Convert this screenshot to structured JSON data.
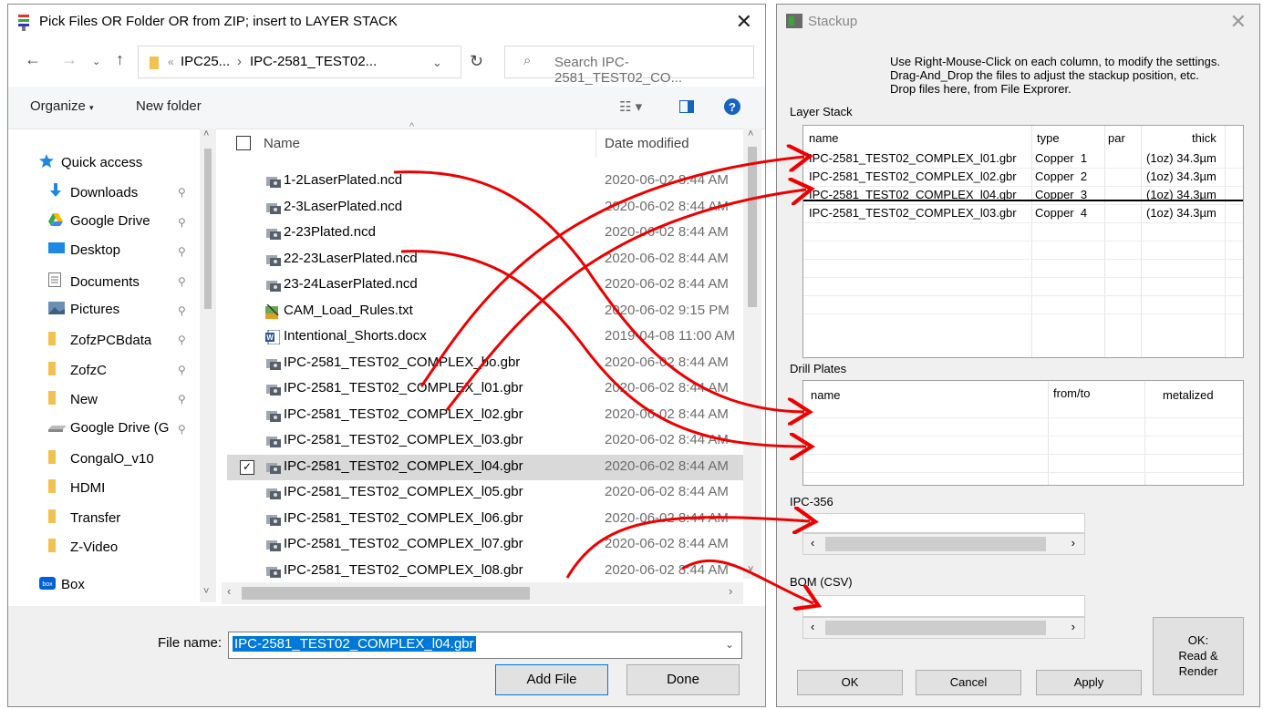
{
  "file_dialog": {
    "title": "Pick Files OR Folder OR from ZIP; insert to LAYER STACK",
    "breadcrumb": [
      "IPC25...",
      "IPC-2581_TEST02..."
    ],
    "search_placeholder": "Search IPC-2581_TEST02_CO...",
    "toolbar": {
      "organize": "Organize",
      "new_folder": "New folder"
    },
    "nav": [
      {
        "label": "Quick access",
        "icon": "star-icon"
      },
      {
        "label": "Downloads",
        "icon": "download-arrow-icon",
        "pinned": true
      },
      {
        "label": "Google Drive",
        "icon": "google-drive-icon",
        "pinned": true
      },
      {
        "label": "Desktop",
        "icon": "desktop-icon",
        "pinned": true
      },
      {
        "label": "Documents",
        "icon": "documents-icon",
        "pinned": true
      },
      {
        "label": "Pictures",
        "icon": "pictures-icon",
        "pinned": true
      },
      {
        "label": "ZofzPCBdata",
        "icon": "folder-icon",
        "pinned": true
      },
      {
        "label": "ZofzC",
        "icon": "folder-icon",
        "pinned": true
      },
      {
        "label": "New",
        "icon": "folder-icon",
        "pinned": true
      },
      {
        "label": "Google Drive (G",
        "icon": "drive-icon",
        "pinned": true
      },
      {
        "label": "CongalO_v10",
        "icon": "folder-icon"
      },
      {
        "label": "HDMI",
        "icon": "folder-icon"
      },
      {
        "label": "Transfer",
        "icon": "folder-icon"
      },
      {
        "label": "Z-Video",
        "icon": "folder-icon"
      },
      {
        "label": "Box",
        "icon": "box-icon"
      }
    ],
    "columns": {
      "name": "Name",
      "date": "Date modified"
    },
    "files": [
      {
        "name": "1-2LaserPlated.ncd",
        "date": "2020-06-02 8:44 AM",
        "icon": "ncd-file-icon"
      },
      {
        "name": "2-3LaserPlated.ncd",
        "date": "2020-06-02 8:44 AM",
        "icon": "ncd-file-icon"
      },
      {
        "name": "2-23Plated.ncd",
        "date": "2020-06-02 8:44 AM",
        "icon": "ncd-file-icon"
      },
      {
        "name": "22-23LaserPlated.ncd",
        "date": "2020-06-02 8:44 AM",
        "icon": "ncd-file-icon"
      },
      {
        "name": "23-24LaserPlated.ncd",
        "date": "2020-06-02 8:44 AM",
        "icon": "ncd-file-icon"
      },
      {
        "name": "CAM_Load_Rules.txt",
        "date": "2020-06-02 9:15 PM",
        "icon": "text-file-icon"
      },
      {
        "name": "Intentional_Shorts.docx",
        "date": "2019-04-08 11:00 AM",
        "icon": "word-file-icon"
      },
      {
        "name": "IPC-2581_TEST02_COMPLEX_bo.gbr",
        "date": "2020-06-02 8:44 AM",
        "icon": "gerber-file-icon"
      },
      {
        "name": "IPC-2581_TEST02_COMPLEX_l01.gbr",
        "date": "2020-06-02 8:44 AM",
        "icon": "gerber-file-icon"
      },
      {
        "name": "IPC-2581_TEST02_COMPLEX_l02.gbr",
        "date": "2020-06-02 8:44 AM",
        "icon": "gerber-file-icon"
      },
      {
        "name": "IPC-2581_TEST02_COMPLEX_l03.gbr",
        "date": "2020-06-02 8:44 AM",
        "icon": "gerber-file-icon"
      },
      {
        "name": "IPC-2581_TEST02_COMPLEX_l04.gbr",
        "date": "2020-06-02 8:44 AM",
        "icon": "gerber-file-icon",
        "selected": true
      },
      {
        "name": "IPC-2581_TEST02_COMPLEX_l05.gbr",
        "date": "2020-06-02 8:44 AM",
        "icon": "gerber-file-icon"
      },
      {
        "name": "IPC-2581_TEST02_COMPLEX_l06.gbr",
        "date": "2020-06-02 8:44 AM",
        "icon": "gerber-file-icon"
      },
      {
        "name": "IPC-2581_TEST02_COMPLEX_l07.gbr",
        "date": "2020-06-02 8:44 AM",
        "icon": "gerber-file-icon"
      },
      {
        "name": "IPC-2581_TEST02_COMPLEX_l08.gbr",
        "date": "2020-06-02 8:44 AM",
        "icon": "gerber-file-icon"
      }
    ],
    "file_name_label": "File name:",
    "file_name_value": "IPC-2581_TEST02_COMPLEX_l04.gbr",
    "add_file": "Add File",
    "done": "Done"
  },
  "stackup": {
    "title": "Stackup",
    "hint": [
      "Use Right-Mouse-Click on each column, to modify the settings.",
      "Drag-And_Drop the files to adjust the stackup position, etc.",
      "Drop files here, from File Exprorer."
    ],
    "layer_stack_label": "Layer Stack",
    "layer_columns": {
      "name": "name",
      "type": "type",
      "par": "par",
      "thick": "thick"
    },
    "layers": [
      {
        "name": "IPC-2581_TEST02_COMPLEX_l01.gbr",
        "type": "Copper  1",
        "par": "",
        "thick": "(1oz) 34.3µm"
      },
      {
        "name": "IPC-2581_TEST02_COMPLEX_l02.gbr",
        "type": "Copper  2",
        "par": "",
        "thick": "(1oz) 34.3µm"
      },
      {
        "name": "IPC-2581_TEST02_COMPLEX_l04.gbr",
        "type": "Copper  3",
        "par": "",
        "thick": "(1oz) 34.3µm"
      },
      {
        "name": "IPC-2581_TEST02_COMPLEX_l03.gbr",
        "type": "Copper  4",
        "par": "",
        "thick": "(1oz) 34.3µm"
      }
    ],
    "drill_label": "Drill Plates",
    "drill_columns": {
      "name": "name",
      "fromto": "from/to",
      "metalized": "metalized"
    },
    "ipc356_label": "IPC-356",
    "bom_label": "BOM (CSV)",
    "buttons": {
      "ok": "OK",
      "cancel": "Cancel",
      "apply": "Apply",
      "ok_render": [
        "OK:",
        "Read &",
        "Render"
      ]
    }
  }
}
